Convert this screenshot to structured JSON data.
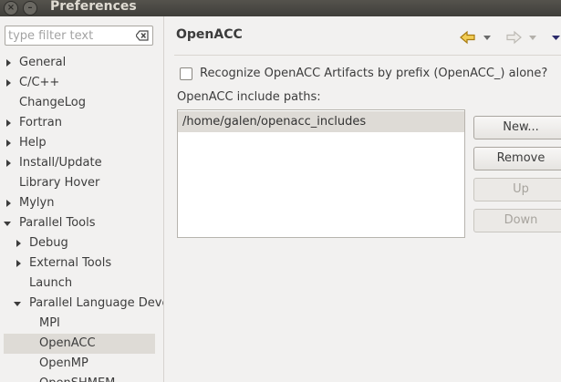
{
  "window": {
    "title": "Preferences",
    "close_glyph": "×",
    "minimize_glyph": "–"
  },
  "filter": {
    "placeholder": "type filter text"
  },
  "tree": {
    "items": [
      {
        "label": "General",
        "expandable": true,
        "expanded": false
      },
      {
        "label": "C/C++",
        "expandable": true,
        "expanded": false
      },
      {
        "label": "ChangeLog",
        "expandable": false
      },
      {
        "label": "Fortran",
        "expandable": true,
        "expanded": false
      },
      {
        "label": "Help",
        "expandable": true,
        "expanded": false
      },
      {
        "label": "Install/Update",
        "expandable": true,
        "expanded": false
      },
      {
        "label": "Library Hover",
        "expandable": false
      },
      {
        "label": "Mylyn",
        "expandable": true,
        "expanded": false
      },
      {
        "label": "Parallel Tools",
        "expandable": true,
        "expanded": true
      },
      {
        "label": "Debug",
        "expandable": true,
        "expanded": false
      },
      {
        "label": "External Tools",
        "expandable": true,
        "expanded": false
      },
      {
        "label": "Launch",
        "expandable": false
      },
      {
        "label": "Parallel Language Deve",
        "expandable": true,
        "expanded": true
      },
      {
        "label": "MPI",
        "expandable": false
      },
      {
        "label": "OpenACC",
        "expandable": false,
        "selected": true
      },
      {
        "label": "OpenMP",
        "expandable": false
      },
      {
        "label": "OpenSHMEM",
        "expandable": false
      }
    ]
  },
  "page": {
    "title": "OpenACC",
    "recognize_label": "Recognize OpenACC Artifacts by prefix (OpenACC_) alone?",
    "recognize_checked": false,
    "include_paths_label": "OpenACC include paths:",
    "include_paths": [
      "/home/galen/openacc_includes"
    ]
  },
  "buttons": {
    "new": "New...",
    "remove": "Remove",
    "up": "Up",
    "down": "Down"
  },
  "colors": {
    "back_arrow": "#e2a72e",
    "selection": "#dedbd6"
  }
}
